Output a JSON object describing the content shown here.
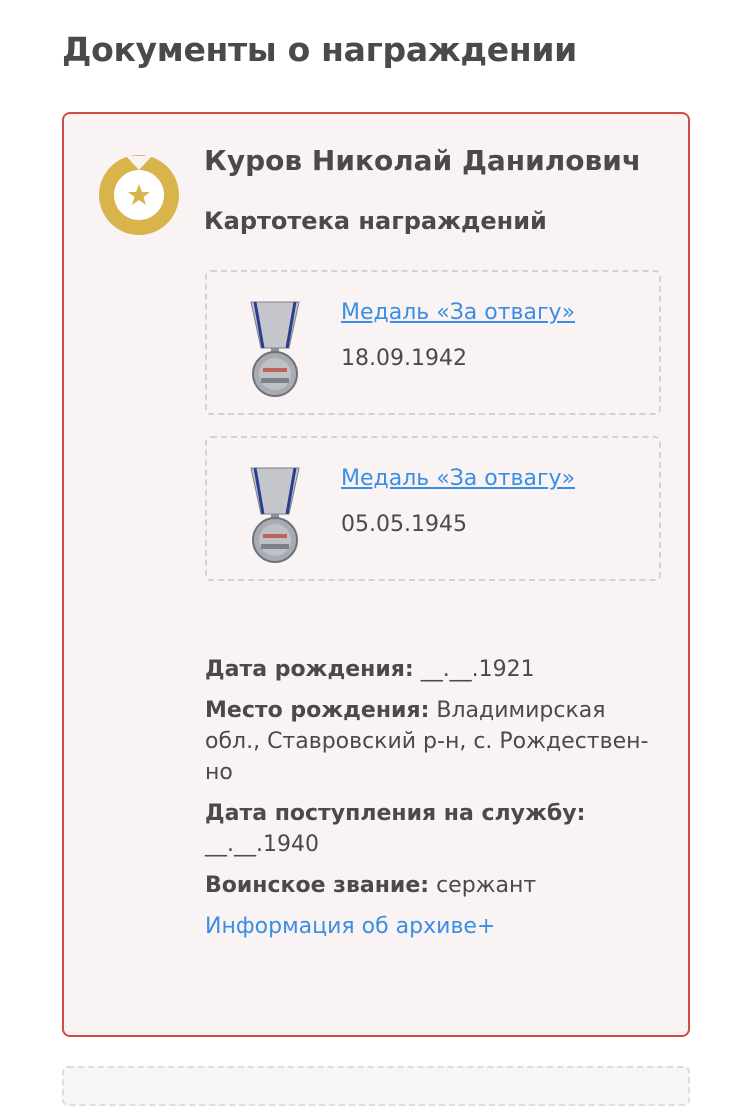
{
  "page": {
    "title": "Документы о награждении"
  },
  "card": {
    "person_name": "Куров Николай Данилович",
    "section_label": "Картотека награждений",
    "badge_icon": "medal-star-icon",
    "colors": {
      "border": "#d24b4b",
      "background": "#f9f3f3",
      "badge": "#d9b44a",
      "link": "#3a8ee6"
    },
    "awards": [
      {
        "name": "Медаль «За отвагу»",
        "date": "18.09.1942",
        "icon": "medal-for-courage-icon"
      },
      {
        "name": "Медаль «За отвагу»",
        "date": "05.05.1945",
        "icon": "medal-for-courage-icon"
      }
    ],
    "info": {
      "birth_date_label": "Дата рождения:",
      "birth_date_value": "__.__.1921",
      "birth_place_label": "Место рождения:",
      "birth_place_value": "Владимирская обл., Ставровский р-н, с. Рождествен­но",
      "service_date_label": "Дата поступления на службу:",
      "service_date_value": "__.__.1940",
      "rank_label": "Воинское звание:",
      "rank_value": "сержант",
      "archive_link": "Информация об архиве+"
    }
  }
}
